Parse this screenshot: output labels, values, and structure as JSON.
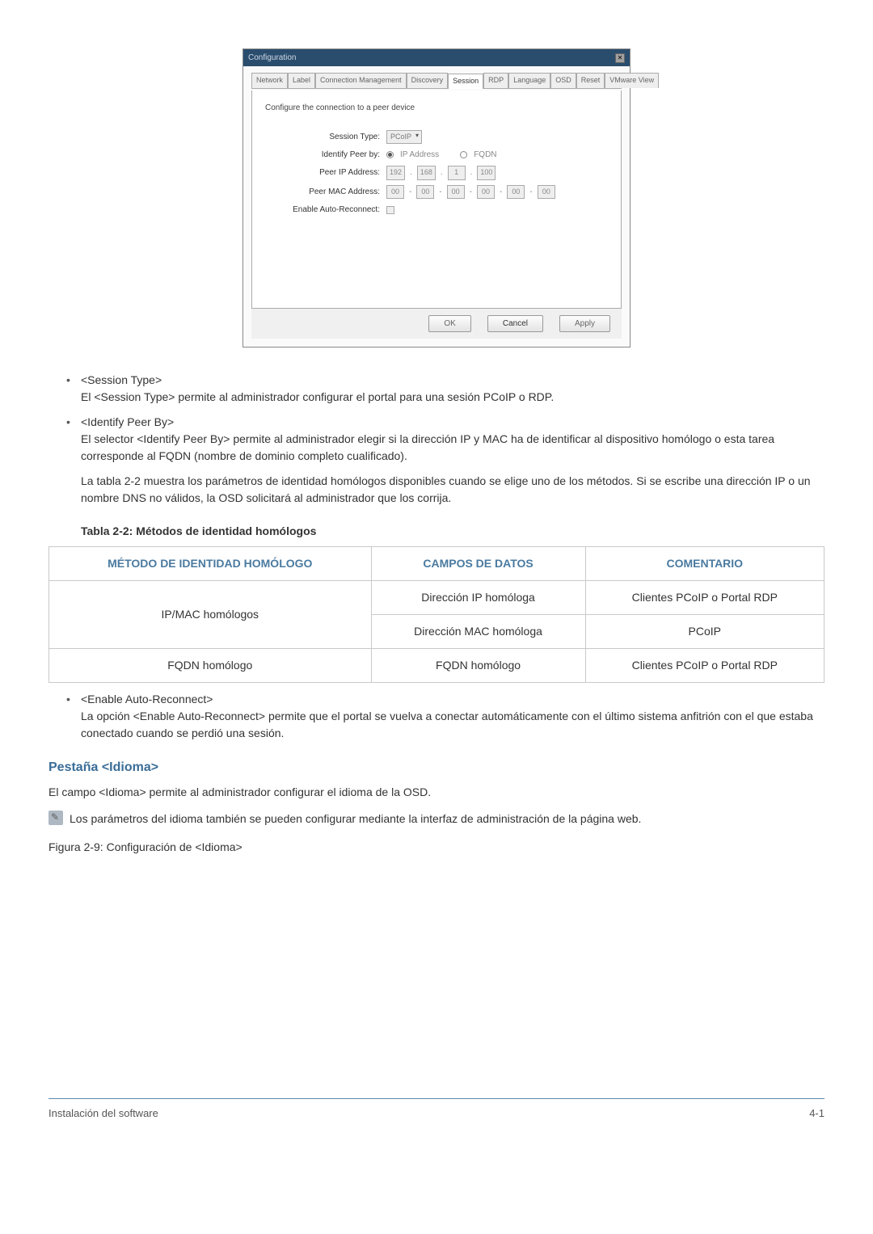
{
  "dialog": {
    "title": "Configuration",
    "tabs": [
      "Network",
      "Label",
      "Connection Management",
      "Discovery",
      "Session",
      "RDP",
      "Language",
      "OSD",
      "Reset",
      "VMware View"
    ],
    "active_tab": "Session",
    "description": "Configure the connection to a peer device",
    "form": {
      "session_type_label": "Session Type:",
      "session_type_value": "PCoIP",
      "identify_label": "Identify Peer by:",
      "identify_opt1": "IP Address",
      "identify_opt2": "FQDN",
      "peer_ip_label": "Peer IP Address:",
      "peer_ip_parts": [
        "192",
        "168",
        "1",
        "100"
      ],
      "peer_mac_label": "Peer MAC Address:",
      "peer_mac_parts": [
        "00",
        "00",
        "00",
        "00",
        "00",
        "00"
      ],
      "auto_reconnect_label": "Enable Auto-Reconnect:"
    },
    "buttons": {
      "ok": "OK",
      "cancel": "Cancel",
      "apply": "Apply"
    }
  },
  "bullets": {
    "b1_head": "<Session Type>",
    "b1_body": "El <Session Type> permite al administrador configurar el portal para una sesión PCoIP o RDP.",
    "b2_head": "<Identify Peer By>",
    "b2_body1": "El selector <Identify Peer By> permite al administrador elegir si la dirección IP y MAC ha de identificar al dispositivo homólogo o esta tarea corresponde al FQDN (nombre de dominio completo cualificado).",
    "b2_body2": "La tabla 2-2 muestra los parámetros de identidad homólogos disponibles cuando se elige uno de los métodos. Si se escribe una dirección IP o un nombre DNS no válidos, la OSD solicitará al administrador que los corrija.",
    "b3_head": "<Enable Auto-Reconnect>",
    "b3_body": "La opción <Enable Auto-Reconnect> permite que el portal se vuelva a conectar automáticamente con el último sistema anfitrión con el que estaba conectado cuando se perdió una sesión."
  },
  "table": {
    "caption": "Tabla 2-2: Métodos de identidad homólogos",
    "h1": "MÉTODO DE IDENTIDAD HOMÓLOGO",
    "h2": "CAMPOS DE DATOS",
    "h3": "COMENTARIO",
    "r1c1": "IP/MAC homólogos",
    "r1c2": "Dirección IP homóloga",
    "r1c3": "Clientes PCoIP o Portal RDP",
    "r2c2": "Dirección MAC homóloga",
    "r2c3": "PCoIP",
    "r3c1": "FQDN homólogo",
    "r3c2": "FQDN homólogo",
    "r3c3": "Clientes PCoIP o Portal RDP"
  },
  "section": {
    "heading": "Pestaña <Idioma>",
    "p1": "El campo <Idioma> permite al administrador configurar el idioma de la OSD.",
    "note": "Los parámetros del idioma también se pueden configurar mediante la interfaz de administración de la página web.",
    "figure": "Figura 2-9: Configuración de <Idioma>"
  },
  "footer": {
    "left": "Instalación del software",
    "right": "4-1"
  }
}
